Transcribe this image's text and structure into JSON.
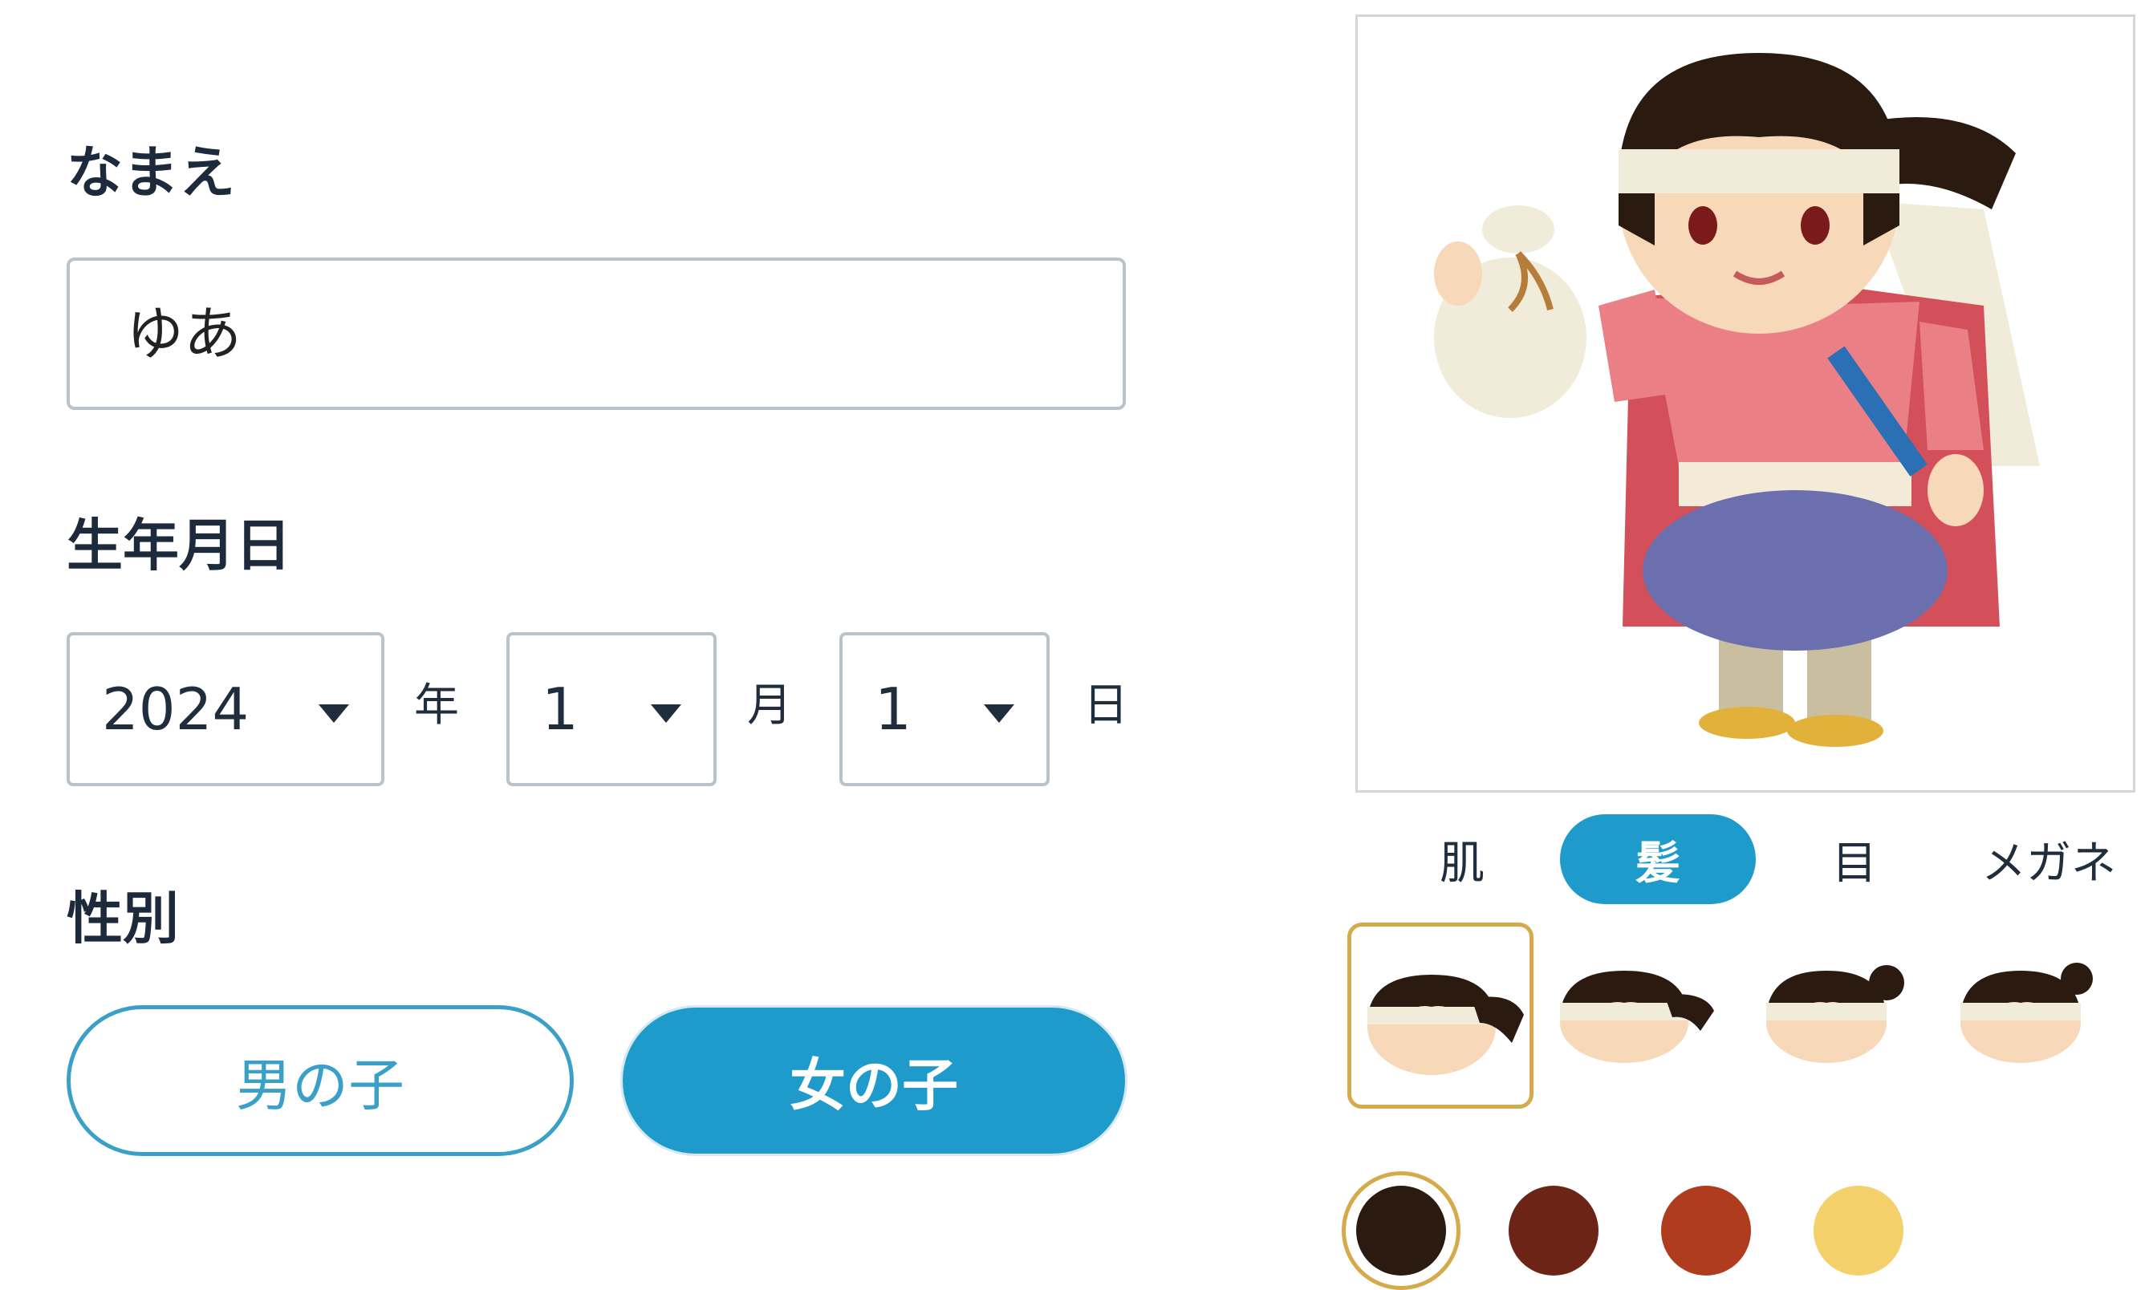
{
  "form": {
    "name_label": "なまえ",
    "name_value": "ゆあ",
    "birthday_label": "生年月日",
    "year_value": "2024",
    "year_unit": "年",
    "month_value": "1",
    "month_unit": "月",
    "day_value": "1",
    "day_unit": "日",
    "gender_label": "性別",
    "gender_options": [
      "男の子",
      "女の子"
    ],
    "gender_selected": "女の子"
  },
  "avatar_editor": {
    "tabs": [
      "肌",
      "髪",
      "目",
      "メガネ"
    ],
    "active_tab": "髪",
    "hair_styles": [
      "long-ponytail-icon",
      "ponytail-icon",
      "bun-icon",
      "side-bun-icon"
    ],
    "selected_hair_style": 0,
    "hair_colors": [
      "#2a1a10",
      "#6b2416",
      "#b03c20",
      "#f4d06a"
    ],
    "selected_hair_color": 0,
    "accent": "#1e9bcb",
    "selection_border": "#d4aa4a"
  }
}
